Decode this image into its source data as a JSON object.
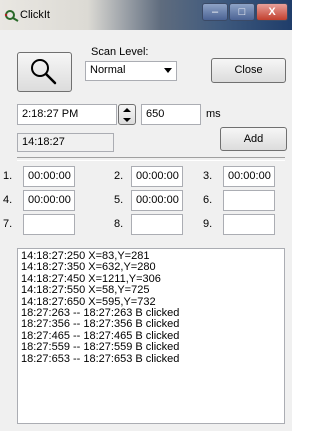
{
  "window": {
    "title": "ClickIt"
  },
  "titlebar": {
    "min_glyph": "–",
    "max_glyph": "□",
    "close_glyph": "X"
  },
  "scan": {
    "label": "Scan Level:",
    "selected": "Normal"
  },
  "buttons": {
    "close_label": "Close",
    "add_label": "Add"
  },
  "time_entry": {
    "value": "2:18:27 PM",
    "ms_value": "650",
    "ms_unit": "ms"
  },
  "clock": {
    "value": "14:18:27"
  },
  "slots": [
    {
      "num": "1.",
      "value": "00:00:00"
    },
    {
      "num": "2.",
      "value": "00:00:00"
    },
    {
      "num": "3.",
      "value": "00:00:00"
    },
    {
      "num": "4.",
      "value": "00:00:00"
    },
    {
      "num": "5.",
      "value": "00:00:00"
    },
    {
      "num": "6.",
      "value": ""
    },
    {
      "num": "7.",
      "value": ""
    },
    {
      "num": "8.",
      "value": ""
    },
    {
      "num": "9.",
      "value": ""
    }
  ],
  "log": [
    "14:18:27:250 X=83,Y=281",
    "14:18:27:350 X=632,Y=280",
    "14:18:27:450 X=1211,Y=306",
    "14:18:27:550 X=58,Y=725",
    "14:18:27:650 X=595,Y=732",
    "18:27:263 -- 18:27:263 B clicked",
    "18:27:356 -- 18:27:356 B clicked",
    "18:27:465 -- 18:27:465 B clicked",
    "18:27:559 -- 18:27:559 B clicked",
    "18:27:653 -- 18:27:653 B clicked"
  ]
}
